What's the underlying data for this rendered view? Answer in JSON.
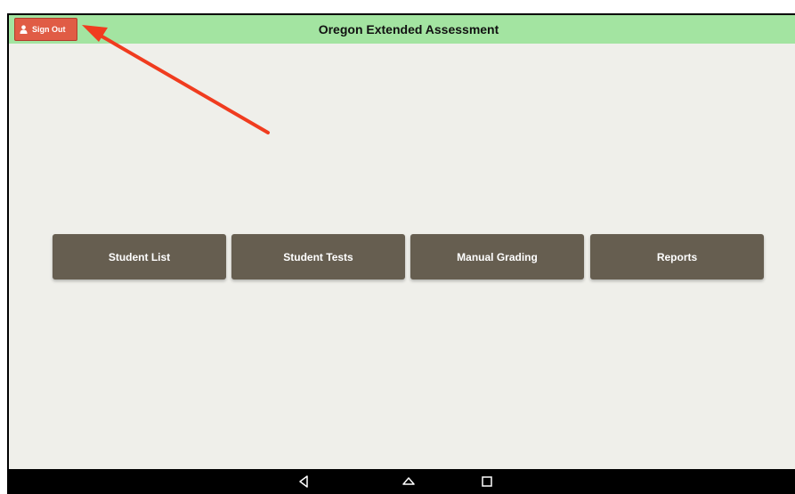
{
  "header": {
    "title": "Oregon Extended Assessment",
    "sign_out_label": "Sign Out"
  },
  "menu": {
    "items": [
      {
        "label": "Student List"
      },
      {
        "label": "Student Tests"
      },
      {
        "label": "Manual Grading"
      },
      {
        "label": "Reports"
      }
    ]
  },
  "navbar": {
    "buttons": [
      "back-icon",
      "home-icon",
      "recents-icon"
    ]
  },
  "colors": {
    "header_bg": "#a3e4a1",
    "sign_out_bg": "#e05c45",
    "tile_bg": "#665e50",
    "screen_bg": "#efefea",
    "annotation_arrow": "#f03c1f"
  },
  "annotation": {
    "type": "arrow",
    "points_to": "sign-out-button"
  }
}
